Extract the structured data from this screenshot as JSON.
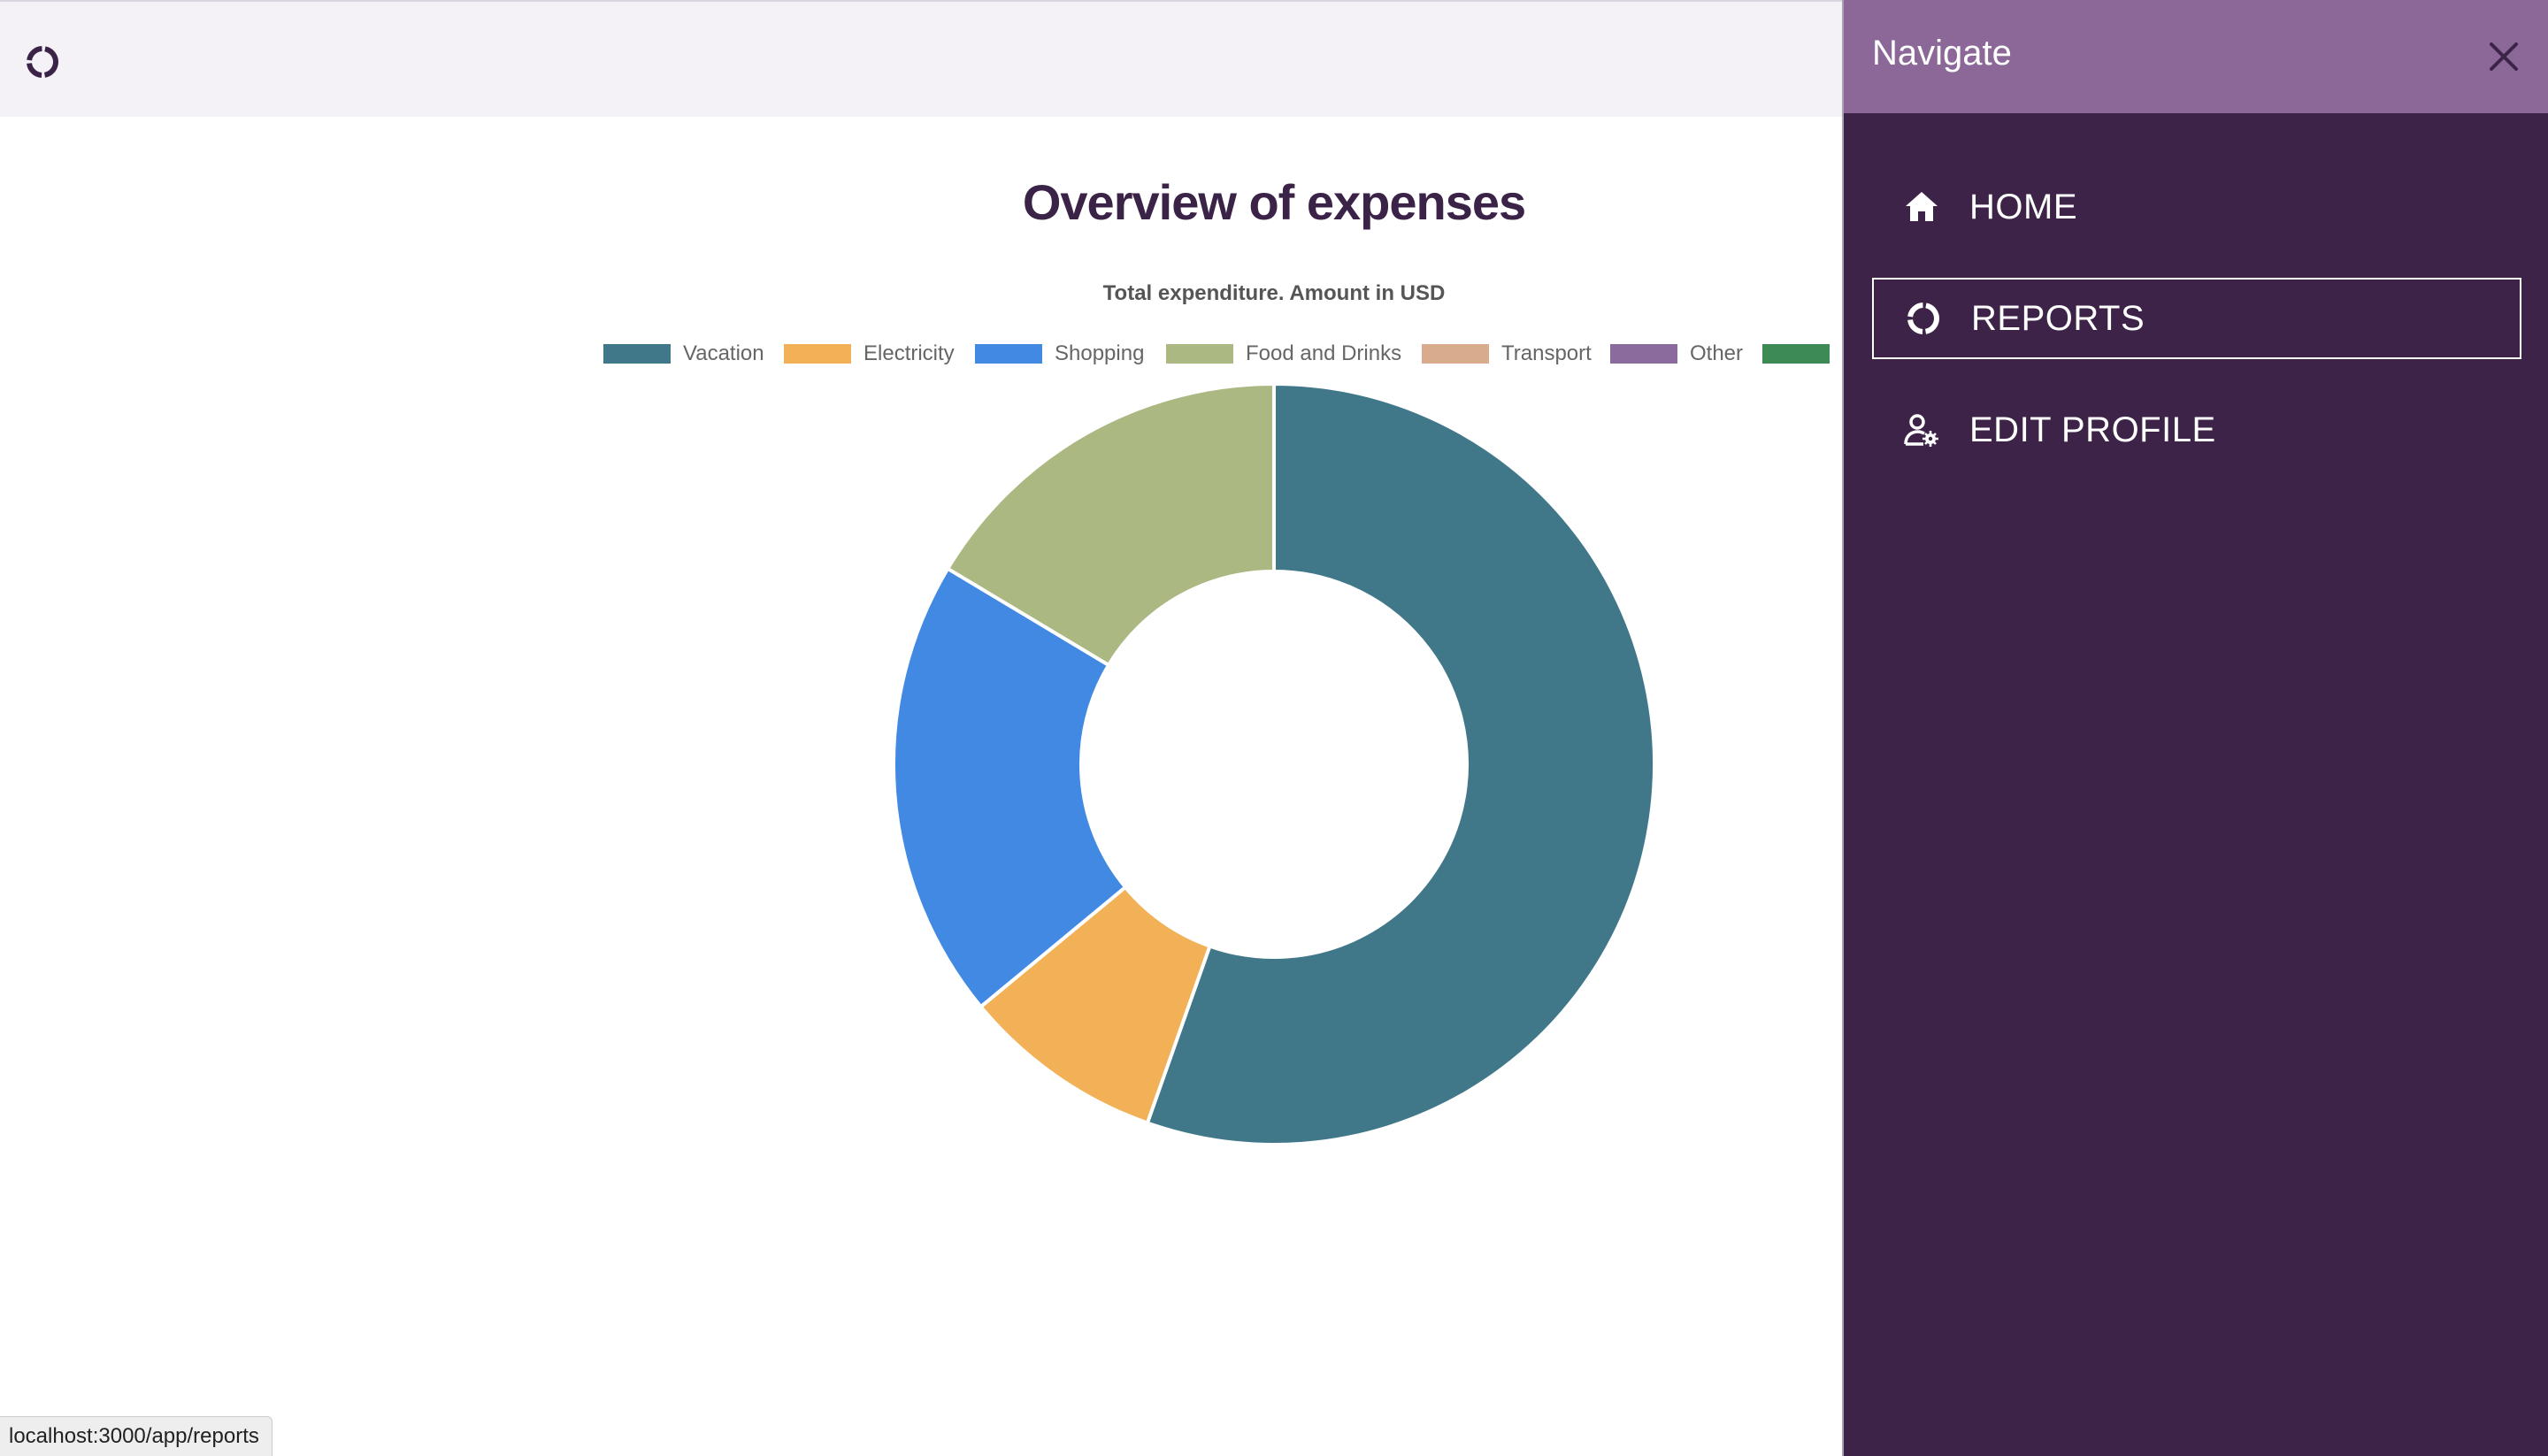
{
  "app": {
    "logo_icon": "donut-logo-icon"
  },
  "page": {
    "title": "Overview of expenses"
  },
  "chart_data": {
    "type": "pie",
    "variant": "doughnut",
    "title": "Total expenditure. Amount in USD",
    "legend_position": "top",
    "categories": [
      "Vacation",
      "Electricity",
      "Shopping",
      "Food and Drinks",
      "Transport",
      "Other",
      ""
    ],
    "values": [
      55.4,
      8.6,
      19.6,
      16.4,
      0,
      0,
      0
    ],
    "colors": [
      "#417889",
      "#f2b057",
      "#4289e3",
      "#abb881",
      "#d8ab8c",
      "#8b6a9e",
      "#3d8a55"
    ]
  },
  "drawer": {
    "title": "Navigate",
    "close_icon": "close-icon",
    "items": [
      {
        "label": "HOME",
        "icon": "home-icon",
        "active": false
      },
      {
        "label": "REPORTS",
        "icon": "donut-chart-icon",
        "active": true
      },
      {
        "label": "EDIT PROFILE",
        "icon": "user-settings-icon",
        "active": false
      }
    ]
  },
  "status_bar": {
    "url": "localhost:3000/app/reports"
  }
}
